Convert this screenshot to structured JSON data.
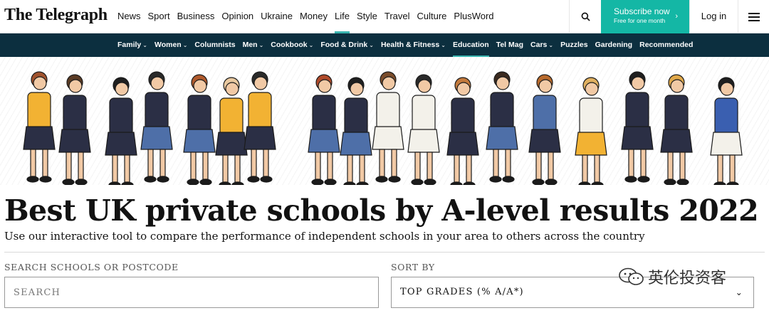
{
  "brand": {
    "logo_text": "The Telegraph"
  },
  "main_nav": [
    {
      "label": "News"
    },
    {
      "label": "Sport"
    },
    {
      "label": "Business"
    },
    {
      "label": "Opinion"
    },
    {
      "label": "Ukraine"
    },
    {
      "label": "Money"
    },
    {
      "label": "Life",
      "active": true
    },
    {
      "label": "Style"
    },
    {
      "label": "Travel"
    },
    {
      "label": "Culture"
    },
    {
      "label": "PlusWord"
    }
  ],
  "header_actions": {
    "search_icon": "search-icon",
    "subscribe_label": "Subscribe now",
    "subscribe_sub": "Free for one month",
    "login_label": "Log in",
    "menu_icon": "hamburger-icon"
  },
  "sub_nav": [
    {
      "label": "Family",
      "dropdown": true
    },
    {
      "label": "Women",
      "dropdown": true
    },
    {
      "label": "Columnists"
    },
    {
      "label": "Men",
      "dropdown": true
    },
    {
      "label": "Cookbook",
      "dropdown": true
    },
    {
      "label": "Food & Drink",
      "dropdown": true
    },
    {
      "label": "Health & Fitness",
      "dropdown": true
    },
    {
      "label": "Education",
      "active": true
    },
    {
      "label": "Tel Mag"
    },
    {
      "label": "Cars",
      "dropdown": true
    },
    {
      "label": "Puzzles"
    },
    {
      "label": "Gardening"
    },
    {
      "label": "Recommended"
    }
  ],
  "article": {
    "title": "Best UK private schools by A-level results 2022",
    "standfirst": "Use our interactive tool to compare the performance of independent schools in your area to others across the country"
  },
  "controls": {
    "search_label": "SEARCH SCHOOLS OR POSTCODE",
    "search_placeholder": "SEARCH",
    "sort_label": "SORT BY",
    "sort_value": "TOP GRADES (% A/A*)"
  },
  "watermark": {
    "text": "英伦投资客"
  },
  "colors": {
    "accent": "#14b7a5",
    "subnav_bg": "#0c2f3f",
    "underline": "#3ab5b0"
  }
}
